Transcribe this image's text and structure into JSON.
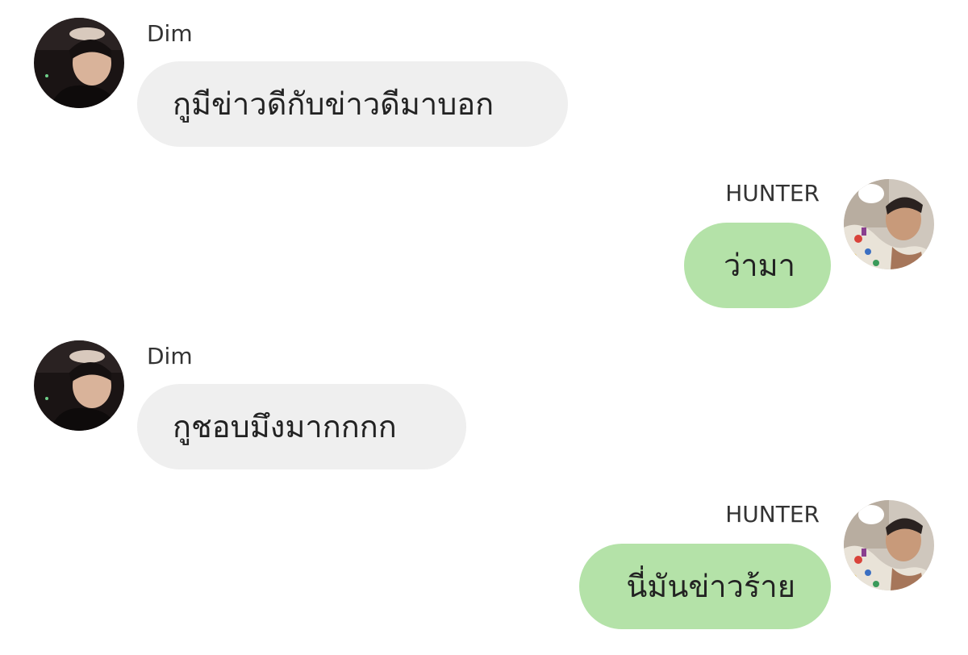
{
  "conversation": {
    "messages": [
      {
        "sender": "Dim",
        "direction": "incoming",
        "text": "กูมีข่าวดีกับข่าวดีมาบอก",
        "avatar_icon": "profile-photo-dim"
      },
      {
        "sender": "HUNTER",
        "direction": "outgoing",
        "text": "ว่ามา",
        "avatar_icon": "profile-photo-hunter"
      },
      {
        "sender": "Dim",
        "direction": "incoming",
        "text": "กูชอบมึงมากกกก",
        "avatar_icon": "profile-photo-dim"
      },
      {
        "sender": "HUNTER",
        "direction": "outgoing",
        "text": "นี่มันข่าวร้าย",
        "avatar_icon": "profile-photo-hunter"
      }
    ]
  },
  "colors": {
    "background": "#ffffff",
    "incoming_bubble": "#efefef",
    "outgoing_bubble": "#b4e2a8",
    "text": "#222222",
    "sender_name": "#333333"
  }
}
